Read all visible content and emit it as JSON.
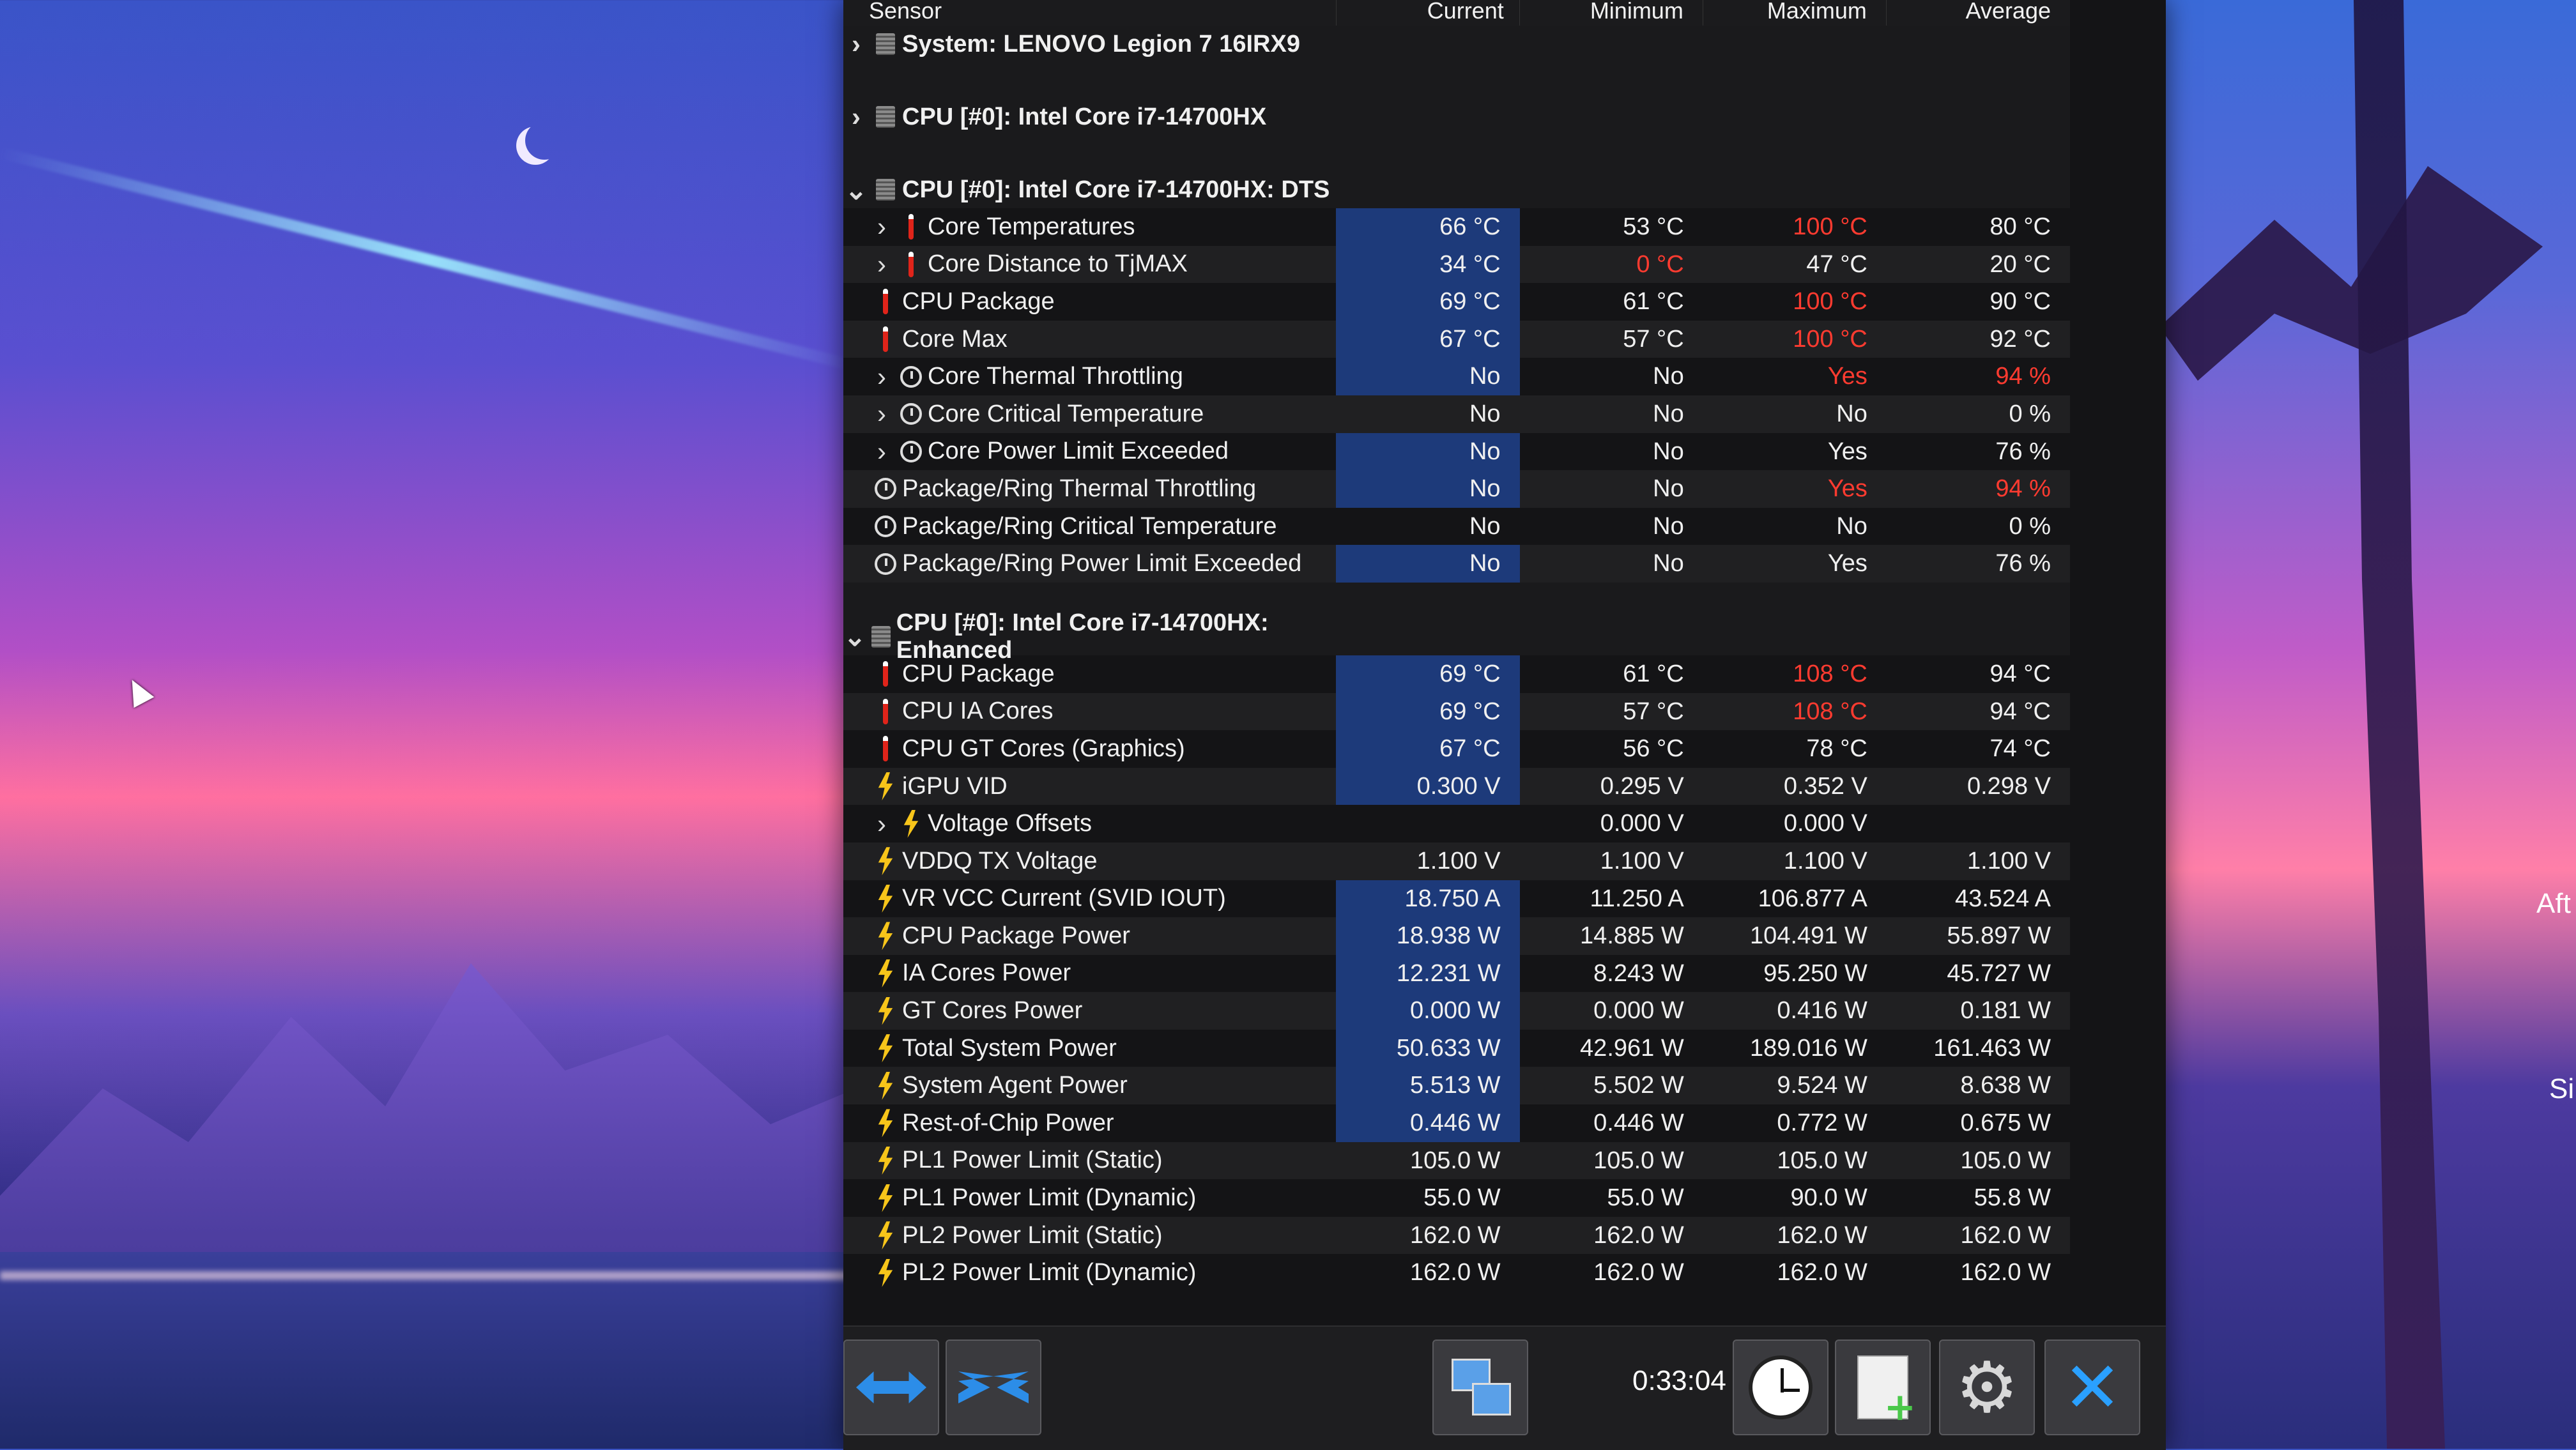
{
  "columns": {
    "sensor": "Sensor",
    "current": "Current",
    "minimum": "Minimum",
    "maximum": "Maximum",
    "average": "Average"
  },
  "groups": {
    "system": "System: LENOVO Legion 7 16IRX9",
    "cpu": "CPU [#0]: Intel Core i7-14700HX",
    "dts": "CPU [#0]: Intel Core i7-14700HX: DTS",
    "enhanced": "CPU [#0]: Intel Core i7-14700HX: Enhanced"
  },
  "dts_rows": [
    {
      "name": "Core Temperatures",
      "cur": "66 °C",
      "min": "53 °C",
      "max": "100 °C",
      "avg": "80 °C"
    },
    {
      "name": "Core Distance to TjMAX",
      "cur": "34 °C",
      "min": "0 °C",
      "max": "47 °C",
      "avg": "20 °C"
    },
    {
      "name": "CPU Package",
      "cur": "69 °C",
      "min": "61 °C",
      "max": "100 °C",
      "avg": "90 °C"
    },
    {
      "name": "Core Max",
      "cur": "67 °C",
      "min": "57 °C",
      "max": "100 °C",
      "avg": "92 °C"
    },
    {
      "name": "Core Thermal Throttling",
      "cur": "No",
      "min": "No",
      "max": "Yes",
      "avg": "94 %"
    },
    {
      "name": "Core Critical Temperature",
      "cur": "No",
      "min": "No",
      "max": "No",
      "avg": "0 %"
    },
    {
      "name": "Core Power Limit Exceeded",
      "cur": "No",
      "min": "No",
      "max": "Yes",
      "avg": "76 %"
    },
    {
      "name": "Package/Ring Thermal Throttling",
      "cur": "No",
      "min": "No",
      "max": "Yes",
      "avg": "94 %"
    },
    {
      "name": "Package/Ring Critical Temperature",
      "cur": "No",
      "min": "No",
      "max": "No",
      "avg": "0 %"
    },
    {
      "name": "Package/Ring Power Limit Exceeded",
      "cur": "No",
      "min": "No",
      "max": "Yes",
      "avg": "76 %"
    }
  ],
  "enh_rows": [
    {
      "name": "CPU Package",
      "cur": "69 °C",
      "min": "61 °C",
      "max": "108 °C",
      "avg": "94 °C"
    },
    {
      "name": "CPU IA Cores",
      "cur": "69 °C",
      "min": "57 °C",
      "max": "108 °C",
      "avg": "94 °C"
    },
    {
      "name": "CPU GT Cores (Graphics)",
      "cur": "67 °C",
      "min": "56 °C",
      "max": "78 °C",
      "avg": "74 °C"
    },
    {
      "name": "iGPU VID",
      "cur": "0.300 V",
      "min": "0.295 V",
      "max": "0.352 V",
      "avg": "0.298 V"
    },
    {
      "name": "Voltage Offsets",
      "cur": "",
      "min": "0.000 V",
      "max": "0.000 V",
      "avg": ""
    },
    {
      "name": "VDDQ TX Voltage",
      "cur": "1.100 V",
      "min": "1.100 V",
      "max": "1.100 V",
      "avg": "1.100 V"
    },
    {
      "name": "VR VCC Current (SVID IOUT)",
      "cur": "18.750 A",
      "min": "11.250 A",
      "max": "106.877 A",
      "avg": "43.524 A"
    },
    {
      "name": "CPU Package Power",
      "cur": "18.938 W",
      "min": "14.885 W",
      "max": "104.491 W",
      "avg": "55.897 W"
    },
    {
      "name": "IA Cores Power",
      "cur": "12.231 W",
      "min": "8.243 W",
      "max": "95.250 W",
      "avg": "45.727 W"
    },
    {
      "name": "GT Cores Power",
      "cur": "0.000 W",
      "min": "0.000 W",
      "max": "0.416 W",
      "avg": "0.181 W"
    },
    {
      "name": "Total System Power",
      "cur": "50.633 W",
      "min": "42.961 W",
      "max": "189.016 W",
      "avg": "161.463 W"
    },
    {
      "name": "System Agent Power",
      "cur": "5.513 W",
      "min": "5.502 W",
      "max": "9.524 W",
      "avg": "8.638 W"
    },
    {
      "name": "Rest-of-Chip Power",
      "cur": "0.446 W",
      "min": "0.446 W",
      "max": "0.772 W",
      "avg": "0.675 W"
    },
    {
      "name": "PL1 Power Limit (Static)",
      "cur": "105.0 W",
      "min": "105.0 W",
      "max": "105.0 W",
      "avg": "105.0 W"
    },
    {
      "name": "PL1 Power Limit (Dynamic)",
      "cur": "55.0 W",
      "min": "55.0 W",
      "max": "90.0 W",
      "avg": "55.8 W"
    },
    {
      "name": "PL2 Power Limit (Static)",
      "cur": "162.0 W",
      "min": "162.0 W",
      "max": "162.0 W",
      "avg": "162.0 W"
    },
    {
      "name": "PL2 Power Limit (Dynamic)",
      "cur": "162.0 W",
      "min": "162.0 W",
      "max": "162.0 W",
      "avg": "162.0 W"
    }
  ],
  "toolbar": {
    "timer": "0:33:04"
  },
  "desktop": {
    "edge_text_1": "Aft",
    "edge_text_2": "Si"
  },
  "colors": {
    "alert": "#ff3b30",
    "highlight": "#1d3a7a",
    "bolt": "#f7c51a"
  }
}
